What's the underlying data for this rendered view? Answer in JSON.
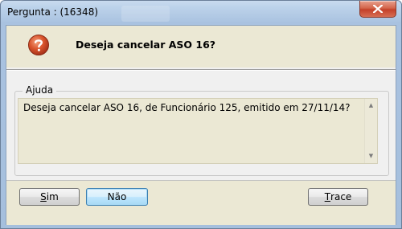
{
  "window": {
    "title": "Pergunta : (16348)"
  },
  "dialog": {
    "question": "Deseja cancelar ASO 16?",
    "help_group_label": "Ajuda",
    "help_text": "Deseja cancelar ASO 16, de Funcionário 125, emitido em 27/11/14?"
  },
  "buttons": {
    "sim": {
      "label_first": "S",
      "label_rest": "im"
    },
    "nao": {
      "label": "Não"
    },
    "trace": {
      "label_first": "T",
      "label_rest": "race"
    }
  },
  "colors": {
    "close_button": "#c4402a",
    "accent_button": "#3c7fb1",
    "panel": "#ebe8d4"
  },
  "icons": {
    "question": "question-icon",
    "close": "close-icon"
  }
}
